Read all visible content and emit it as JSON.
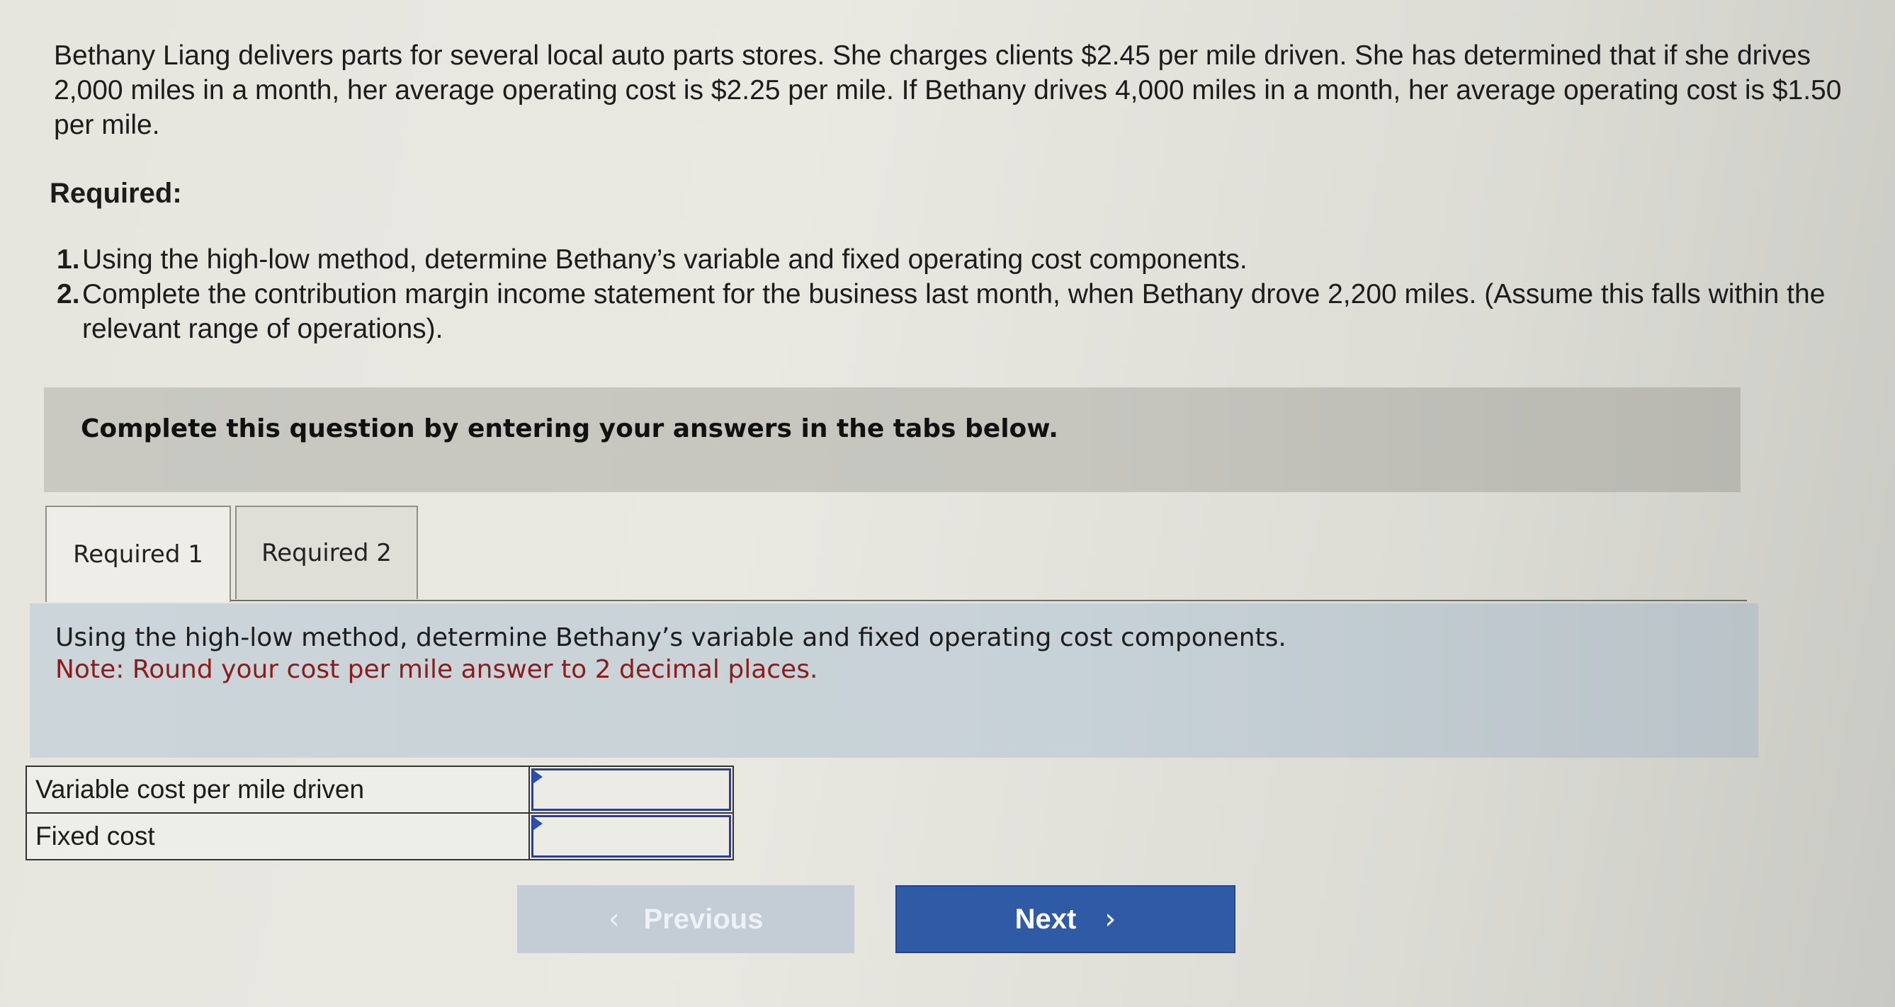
{
  "problem": {
    "text": "Bethany Liang delivers parts for several local auto parts stores. She charges clients $2.45 per mile driven. She has determined that if she drives 2,000 miles in a month, her average operating cost is $2.25 per mile. If Bethany drives 4,000 miles in a month, her average operating cost is $1.50 per mile."
  },
  "required": {
    "heading": "Required:",
    "items": [
      {
        "num": "1.",
        "text": "Using the high-low method, determine Bethany’s variable and fixed operating cost components."
      },
      {
        "num": "2.",
        "text": "Complete the contribution margin income statement for the business last month, when Bethany drove 2,200 miles. (Assume this falls within the relevant range of operations)."
      }
    ]
  },
  "banner": {
    "text": "Complete this question by entering your answers in the tabs below."
  },
  "tabs": [
    {
      "label": "Required 1",
      "active": true
    },
    {
      "label": "Required 2",
      "active": false
    }
  ],
  "instruction": {
    "main": "Using the high-low method, determine Bethany’s variable and fixed operating cost components.",
    "note": "Note: Round your cost per mile answer to 2 decimal places."
  },
  "answer_table": {
    "rows": [
      {
        "label": "Variable cost per mile driven",
        "value": ""
      },
      {
        "label": "Fixed cost",
        "value": ""
      }
    ]
  },
  "nav": {
    "previous_label": "Previous",
    "next_label": "Next",
    "previous_icon": "chevron-left-icon",
    "next_icon": "chevron-right-icon"
  },
  "colors": {
    "next_button": "#2f5aa6",
    "previous_button_disabled": "#c4ccd6",
    "note_text": "#8b1c1c",
    "input_border": "#2f3f8f"
  }
}
